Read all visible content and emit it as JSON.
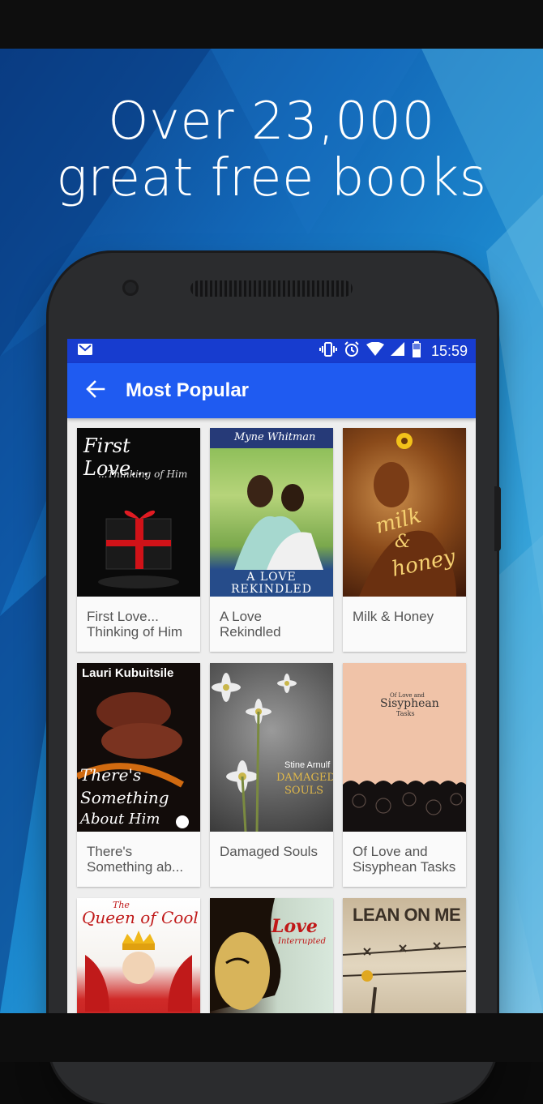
{
  "headline": {
    "line1": "Over 23,000",
    "line2": "great free books"
  },
  "status_bar": {
    "time": "15:59",
    "icons": [
      "gmail-icon",
      "vibrate-icon",
      "alarm-icon",
      "wifi-icon",
      "signal-icon",
      "battery-icon"
    ]
  },
  "app_bar": {
    "title": "Most Popular",
    "back_icon": "arrow-back-icon"
  },
  "books": [
    {
      "title": "First Love... Thinking of Him",
      "cover_text": [
        "First Love...",
        "...Thinking of Him"
      ]
    },
    {
      "title": "A Love Rekindled",
      "cover_text": [
        "Myne Whitman",
        "A LOVE",
        "REKINDLED"
      ]
    },
    {
      "title": "Milk & Honey",
      "cover_text": [
        "milk",
        "&",
        "honey"
      ]
    },
    {
      "title": "There's Something ab...",
      "cover_text": [
        "Lauri Kubuitsile",
        "There's",
        "Something",
        "About Him"
      ]
    },
    {
      "title": "Damaged Souls",
      "cover_text": [
        "Stine Arnulf",
        "DAMAGED",
        "SOULS"
      ]
    },
    {
      "title": "Of Love and Sisyphean Tasks",
      "cover_text": [
        "Of Love and",
        "Sisyphean",
        "Tasks"
      ]
    },
    {
      "title": "",
      "cover_text": [
        "The",
        "Queen of Cool"
      ]
    },
    {
      "title": "",
      "cover_text": [
        "Love",
        "Interrupted"
      ]
    },
    {
      "title": "",
      "cover_text": [
        "LEAN ON ME"
      ]
    }
  ],
  "colors": {
    "app_bar": "#1f5bf1",
    "status_bar": "#173ccf",
    "promo_bg": "#1266b6"
  }
}
